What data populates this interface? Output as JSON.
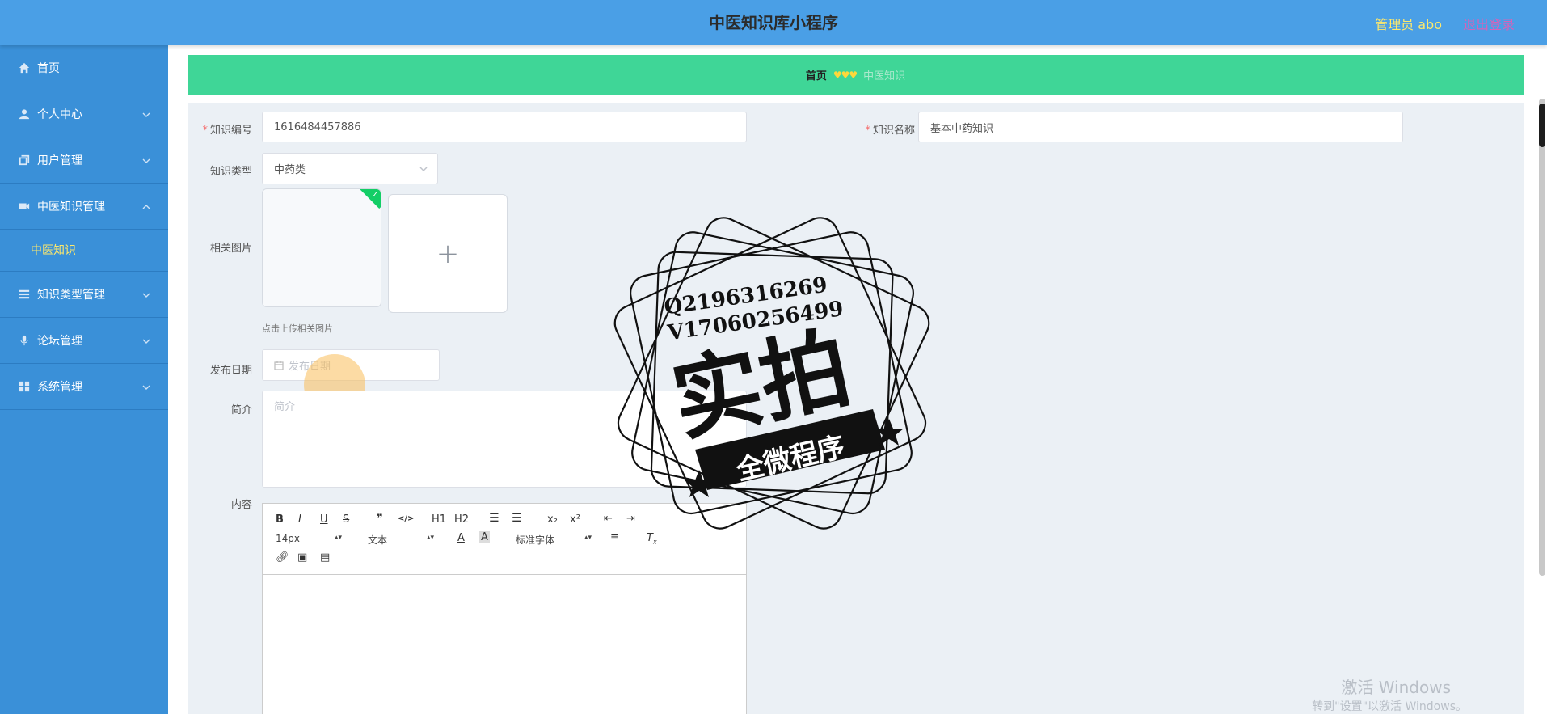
{
  "header": {
    "title": "中医知识库小程序",
    "admin_label": "管理员 abo",
    "logout_label": "退出登录"
  },
  "sidebar": {
    "items": [
      {
        "label": "首页",
        "icon": "home-icon"
      },
      {
        "label": "个人中心",
        "icon": "user-icon"
      },
      {
        "label": "用户管理",
        "icon": "copy-icon"
      },
      {
        "label": "中医知识管理",
        "icon": "video-icon"
      },
      {
        "label": "知识类型管理",
        "icon": "menu-icon"
      },
      {
        "label": "论坛管理",
        "icon": "microphone-icon"
      },
      {
        "label": "系统管理",
        "icon": "grid-icon"
      }
    ],
    "active_sub_item": "中医知识"
  },
  "breadcrumb": {
    "home": "首页",
    "separator": "♥♥♥",
    "current": "中医知识"
  },
  "form": {
    "code_label": "知识编号",
    "code_value": "1616484457886",
    "name_label": "知识名称",
    "name_value": "基本中药知识",
    "type_label": "知识类型",
    "type_value": "中药类",
    "image_label": "相关图片",
    "image_hint": "点击上传相关图片",
    "date_label": "发布日期",
    "date_placeholder": "发布日期",
    "intro_label": "简介",
    "intro_placeholder": "简介",
    "content_label": "内容"
  },
  "editor": {
    "bold": "B",
    "italic": "I",
    "underline": "U",
    "strike": "S",
    "quote": "❞",
    "code": "</>",
    "h1": "H1",
    "h2": "H2",
    "subscript": "x₂",
    "superscript": "x²",
    "font_size": "14px",
    "text_style": "文本",
    "font_family": "标准字体"
  },
  "stamp": {
    "line1": "Q2196316269",
    "line2": "V17060256499",
    "main": "实拍",
    "banner": "全微程序"
  },
  "os_watermark": {
    "title": "激活 Windows",
    "subtitle": "转到\"设置\"以激活 Windows。"
  },
  "colors": {
    "header": "#4a9fe6",
    "sidebar": "#3a90d8",
    "breadcrumb": "#3fd697",
    "accent_yellow": "#ffe96b",
    "logout": "#d463b9",
    "required": "#f56c6c"
  }
}
